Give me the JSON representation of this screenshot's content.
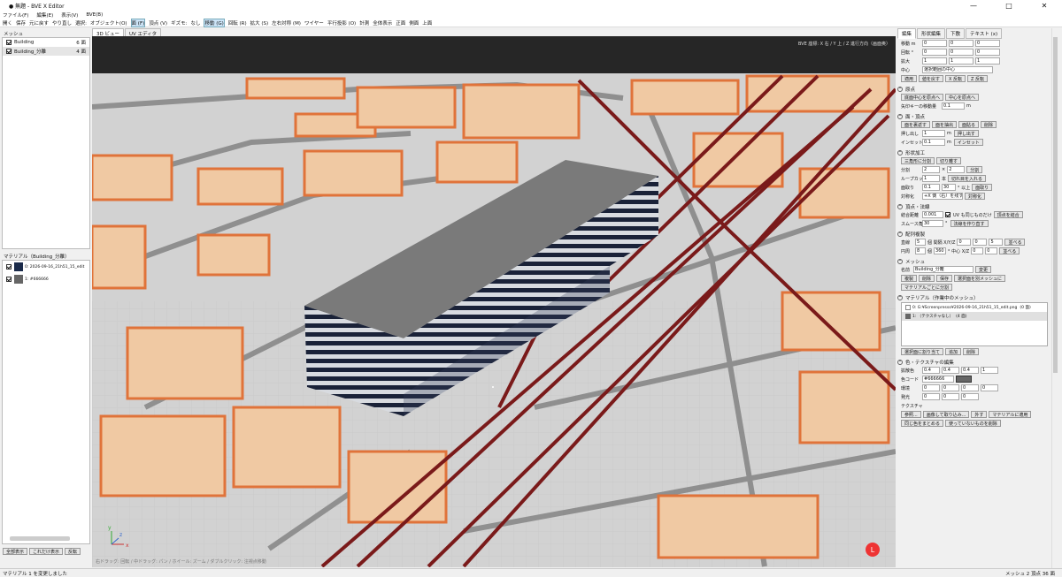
{
  "window": {
    "title": "● 無題 - BVE X Editor",
    "min": "—",
    "max": "□",
    "close": "✕"
  },
  "menu": [
    "ファイル(F)",
    "編集(E)",
    "表示(V)",
    "BVE(B)"
  ],
  "toolbar": [
    {
      "label": "開く",
      "on": false
    },
    {
      "label": "保存",
      "on": false
    },
    {
      "label": "元に戻す",
      "on": false
    },
    {
      "label": "やり直し",
      "on": false
    },
    {
      "label": "選択:",
      "on": false
    },
    {
      "label": "オブジェクト(O)",
      "on": false
    },
    {
      "label": "面 (F)",
      "on": true
    },
    {
      "label": "頂点 (V)",
      "on": false
    },
    {
      "label": "ギズモ:",
      "on": false
    },
    {
      "label": "なし",
      "on": false
    },
    {
      "label": "移動 (G)",
      "on": true
    },
    {
      "label": "回転 (R)",
      "on": false
    },
    {
      "label": "拡大 (S)",
      "on": false
    },
    {
      "label": "左右対称 (M)",
      "on": false
    },
    {
      "label": "ワイヤー",
      "on": false
    },
    {
      "label": "平行投影 (O)",
      "on": false
    },
    {
      "label": "計測",
      "on": false
    },
    {
      "label": "全体表示",
      "on": false
    },
    {
      "label": "正面",
      "on": false
    },
    {
      "label": "側面",
      "on": false
    },
    {
      "label": "上面",
      "on": false
    }
  ],
  "mesh_panel": {
    "header": "メッシュ",
    "items": [
      {
        "name": "Building",
        "count": "6 面",
        "checked": true
      },
      {
        "name": "Building_分離",
        "count": "4 面",
        "checked": true
      }
    ]
  },
  "material_panel": {
    "header": "マテリアル（Building_分離）",
    "items": [
      {
        "label": "0: 2026-09-16_21h51_15_edit",
        "color": "#1a2a4a",
        "checked": true
      },
      {
        "label": "1: #666666",
        "color": "#666666",
        "checked": true
      }
    ],
    "buttons": [
      "全部表示",
      "これだけ表示",
      "反転"
    ]
  },
  "view_tabs": [
    "3D ビュー",
    "UV エディタ"
  ],
  "viewport": {
    "hint": "BVE 座標: X 右 / Y 上 / Z 進行方向（画面奥）",
    "axis_x": "x",
    "axis_y": "y",
    "axis_z": "z",
    "gizmo_label": "L",
    "footer": "右ドラッグ: 回転 / 中ドラッグ: パン / ホイール: ズーム / ダブルクリック: 注視点移動"
  },
  "right_tabs": [
    "編集",
    "形状編集",
    "下敷",
    "テキスト (x)"
  ],
  "transform": {
    "move_label": "移動 m",
    "move": [
      "0",
      "0",
      "0"
    ],
    "rot_label": "回転 °",
    "rot": [
      "0",
      "0",
      "0"
    ],
    "scale_label": "拡大",
    "scale": [
      "1",
      "1",
      "1"
    ],
    "center_label": "中心",
    "center": "選択範囲の中心",
    "buttons": [
      "適用",
      "値を戻す",
      "X 反転",
      "Z 反転"
    ]
  },
  "origin": {
    "title": "原点",
    "buttons": [
      "底面中心を原点へ",
      "中心を原点へ"
    ],
    "arrow_label": "矢印キーの移動量",
    "arrow_value": "0.1",
    "arrow_unit": "m"
  },
  "face_vertex": {
    "title": "面・頂点",
    "buttons": [
      "面を裏返す",
      "面を抽出",
      "面貼る",
      "削除"
    ],
    "push_label": "押し出し",
    "push_value": "1",
    "push_unit": "m",
    "push_btn": "押し出す",
    "inset_label": "インセット",
    "inset_value": "0.1",
    "inset_unit": "m",
    "inset_btn": "インセット"
  },
  "shape": {
    "title": "形状加工",
    "buttons": [
      "三角形に分割",
      "切り離す"
    ],
    "div_label": "分割",
    "div_a": "2",
    "div_x": "×",
    "div_b": "2",
    "div_btn": "分割",
    "loop_label": "ループカット",
    "loop_value": "1",
    "loop_unit": "本",
    "loop_btn": "切れ目を入れる",
    "bevel_label": "面取り",
    "bevel_a": "0.1",
    "bevel_b": "30",
    "bevel_unit": "° 以上",
    "bevel_btn": "面取り",
    "sym_label": "対称化",
    "sym_value": "+X 側（右）を残す",
    "sym_btn": "対称化"
  },
  "merge": {
    "title": "頂点・法線",
    "tol_label": "結合距離",
    "tol_value": "0.001",
    "uv_label": "UV も同じものだけ",
    "merge_btn": "頂点を結合",
    "smooth_label": "スムース角",
    "smooth_value": "30",
    "smooth_unit": "°",
    "normal_btn": "法線を作り直す"
  },
  "array": {
    "title": "配列複製",
    "lin_label": "直線",
    "lin_count": "5",
    "lin_unit": "個 間隔 X/Y/Z",
    "lin_x": "0",
    "lin_y": "0",
    "lin_z": "5",
    "lin_btn": "並べる",
    "cir_label": "円周",
    "cir_count": "8",
    "cir_unit": "個",
    "cir_deg": "360",
    "cir_unit2": "° 中心 X/Z",
    "cir_x": "0",
    "cir_z": "0",
    "cir_btn": "並べる"
  },
  "mesh": {
    "title": "メッシュ",
    "name_label": "名前",
    "name_value": "Building_分離",
    "rename_btn": "変更",
    "buttons": [
      "複製",
      "削除",
      "保存",
      "選択面を別メッシュに"
    ],
    "split_btn": "マテリアルごとに分割"
  },
  "material_list": {
    "title": "マテリアル（作業中のメッシュ）",
    "items": [
      {
        "label": "0: G:¥Screenpresso¥2026-09-16_21h51_15_edit.png",
        "count": "(0 面)"
      },
      {
        "label": "1: （テクスチャなし）",
        "count": "(4 面)"
      }
    ],
    "buttons": [
      "選択面に割り当て",
      "追加",
      "削除"
    ]
  },
  "color": {
    "title": "色・テクスチャの編集",
    "base_label": "拡散色",
    "base": [
      "0.4",
      "0.4",
      "0.4",
      "1"
    ],
    "code_label": "色コード",
    "code": "#666666",
    "code_color": "#666666",
    "amb_label": "環境",
    "amb": [
      "0",
      "0",
      "0",
      "0"
    ],
    "emi_label": "発光",
    "emi": [
      "0",
      "0",
      "0"
    ],
    "tex_label": "テクスチャ",
    "tex_buttons": [
      "参照...",
      "画像して取り込み...",
      "外す",
      "マテリアルに適用"
    ],
    "bottom_buttons": [
      "同じ色をまとめる",
      "使っていないものを削除"
    ]
  },
  "status": {
    "left": "マテリアル 1 を変更しました",
    "right": "メッシュ 2  頂点 36  面"
  }
}
